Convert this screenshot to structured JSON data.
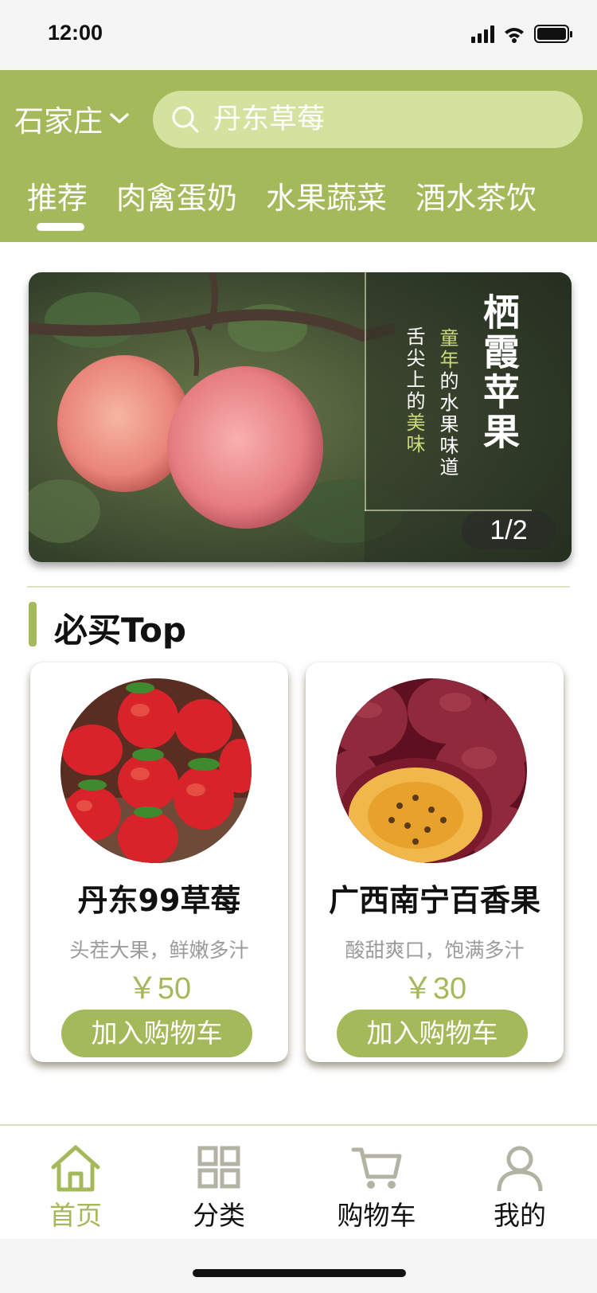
{
  "status": {
    "time": "12:00"
  },
  "header": {
    "city": "石家庄",
    "search_placeholder": "丹东草莓",
    "tabs": [
      {
        "label": "推荐",
        "active": true
      },
      {
        "label": "肉禽蛋奶",
        "active": false
      },
      {
        "label": "水果蔬菜",
        "active": false
      },
      {
        "label": "酒水茶饮",
        "active": false
      }
    ]
  },
  "banner": {
    "title": "栖霞苹果",
    "subtitle_1_a": "童年",
    "subtitle_1_b": "的水果味道",
    "subtitle_2_a": "舌尖上的",
    "subtitle_2_b": "美味",
    "pager": "1/2"
  },
  "section": {
    "title": "必买Top"
  },
  "products": [
    {
      "name": "丹东99草莓",
      "desc": "头茬大果，鲜嫩多汁",
      "price": "￥50",
      "button": "加入购物车"
    },
    {
      "name": "广西南宁百香果",
      "desc": "酸甜爽口，饱满多汁",
      "price": "￥30",
      "button": "加入购物车"
    }
  ],
  "nav": [
    {
      "label": "首页",
      "icon": "home-icon",
      "active": true
    },
    {
      "label": "分类",
      "icon": "grid-icon",
      "active": false
    },
    {
      "label": "购物车",
      "icon": "cart-icon",
      "active": false
    },
    {
      "label": "我的",
      "icon": "user-icon",
      "active": false
    }
  ],
  "colors": {
    "accent": "#a4b95a",
    "search_bg": "#d4e29f",
    "price": "#a4b95a"
  }
}
